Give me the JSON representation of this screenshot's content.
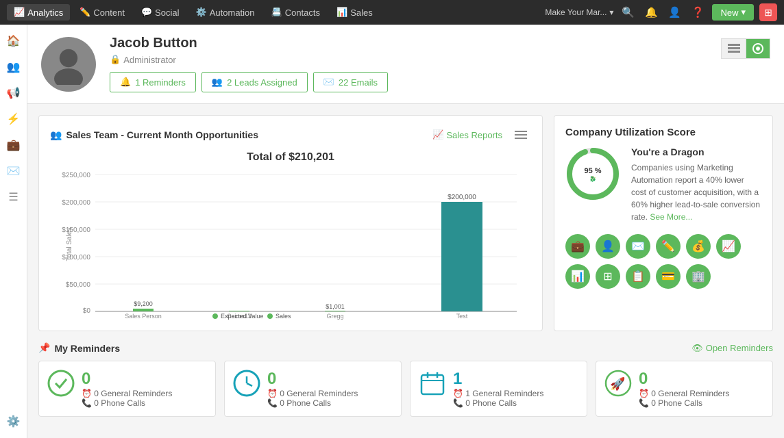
{
  "topnav": {
    "items": [
      {
        "label": "Analytics",
        "icon": "📈",
        "active": true
      },
      {
        "label": "Content",
        "icon": "✏️"
      },
      {
        "label": "Social",
        "icon": "💬"
      },
      {
        "label": "Automation",
        "icon": "⚙️"
      },
      {
        "label": "Contacts",
        "icon": "📇"
      },
      {
        "label": "Sales",
        "icon": "📊"
      }
    ],
    "brand": "Make Your Mar...",
    "new_label": "New"
  },
  "sidebar": {
    "icons": [
      "home",
      "users",
      "megaphone",
      "filter",
      "briefcase",
      "mail",
      "list",
      "settings",
      "gear"
    ]
  },
  "profile": {
    "name": "Jacob Button",
    "role": "Administrator",
    "buttons": [
      {
        "label": "1 Reminders",
        "icon": "🔔"
      },
      {
        "label": "2 Leads Assigned",
        "icon": "👥"
      },
      {
        "label": "22 Emails",
        "icon": "✉️"
      }
    ]
  },
  "chart": {
    "title": "Sales Team - Current Month Opportunities",
    "title_icon": "👥",
    "reports_link": "Sales Reports",
    "total": "Total of $210,201",
    "y_labels": [
      "$250,000",
      "$200,000",
      "$150,000",
      "$100,000",
      "$50,000",
      "$0"
    ],
    "x_axis_label": "Sales Person",
    "bars": [
      {
        "label": "Sales Person",
        "expected": 9200,
        "sales": 9200,
        "display_expected": "$9,200"
      },
      {
        "label": "Cairos13",
        "expected": 0,
        "sales": 0
      },
      {
        "label": "Gregg",
        "expected": 1001,
        "sales": 1001,
        "display_sales": "$1,001"
      },
      {
        "label": "Test",
        "expected": 200000,
        "sales": 200000,
        "display": "$200,000"
      }
    ],
    "legend": [
      {
        "label": "Expected Value",
        "color": "#5cb85c"
      },
      {
        "label": "Sales",
        "color": "#5cb85c"
      }
    ]
  },
  "score": {
    "title": "Company Utilization Score",
    "dragon_title": "You're a Dragon",
    "percentage": "95 %",
    "description": "Companies using Marketing Automation report a 40% lower cost of customer acquisition, with a 60% higher lead-to-sale conversion rate.",
    "see_more": "See More...",
    "icons": [
      "💼",
      "👤",
      "✉️",
      "✏️",
      "💰",
      "📈",
      "📊",
      "📋",
      "💳",
      "🏢"
    ]
  },
  "reminders": {
    "title": "My Reminders",
    "title_icon": "🔔",
    "open_link": "Open Reminders",
    "cards": [
      {
        "icon_color": "#5cb85c",
        "count": "0",
        "general": "0 General Reminders",
        "phone": "0 Phone Calls"
      },
      {
        "icon_color": "#17a2b8",
        "count": "0",
        "general": "0 General Reminders",
        "phone": "0 Phone Calls"
      },
      {
        "icon_color": "#17a2b8",
        "count": "1",
        "general": "1 General Reminders",
        "phone": "0 Phone Calls"
      },
      {
        "icon_color": "#5cb85c",
        "count": "0",
        "general": "0 General Reminders",
        "phone": "0 Phone Calls"
      }
    ]
  }
}
